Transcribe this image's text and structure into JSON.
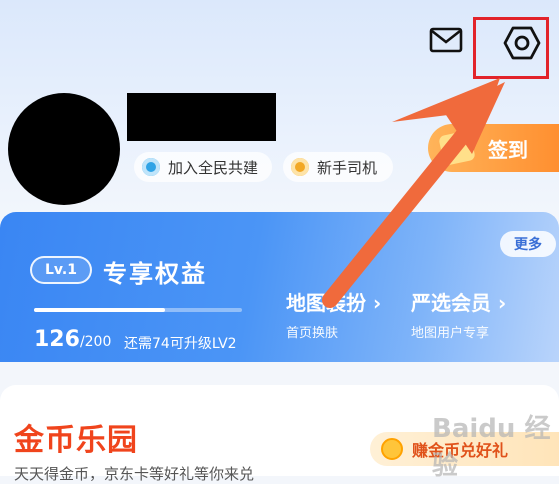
{
  "header": {
    "icons": [
      "mail-icon",
      "gear-icon"
    ],
    "highlight_color": "#e2232a"
  },
  "profile": {
    "chips": [
      {
        "label": "加入全民共建",
        "icon": "globe-icon",
        "color": "#2fa3e6"
      },
      {
        "label": "新手司机",
        "icon": "medal-icon",
        "color": "#f2a825"
      }
    ],
    "checkin_label": "签到"
  },
  "benefits": {
    "level_badge": "Lv.1",
    "title": "专享权益",
    "progress": 0.63,
    "xp_current": "126",
    "xp_max": "/200",
    "xp_hint": "还需74可升级LV2",
    "more_label": "更多",
    "features": [
      {
        "title": "地图装扮 ›",
        "subtitle": "首页换肤"
      },
      {
        "title": "严选会员 ›",
        "subtitle": "地图用户专享"
      }
    ]
  },
  "gold_park": {
    "title": "金币乐园",
    "subtitle": "天天得金币，京东卡等好礼等你来兑",
    "redeem_label": "赚金币兑好礼"
  },
  "watermark": "Baidu 经验",
  "colors": {
    "accent_blue": "#3a86f3",
    "checkin_orange": "#ff8a2a",
    "arrow_orange": "#f06a3c",
    "gold_red": "#f0441c"
  }
}
